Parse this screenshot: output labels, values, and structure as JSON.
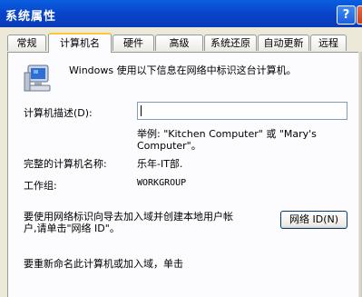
{
  "window": {
    "title": "系统属性",
    "help_label": "?"
  },
  "tabs": [
    {
      "label": "常规"
    },
    {
      "label": "计算机名"
    },
    {
      "label": "硬件"
    },
    {
      "label": "高级"
    },
    {
      "label": "系统还原"
    },
    {
      "label": "自动更新"
    },
    {
      "label": "远程"
    }
  ],
  "active_tab": "计算机名",
  "content": {
    "intro": "Windows 使用以下信息在网络中标识这台计算机。",
    "desc_label": "计算机描述(D):",
    "desc_value": "",
    "example_line1": "举例: \"Kitchen Computer\" 或 \"Mary's",
    "example_line2": "Computer\"。",
    "fullname_label": "完整的计算机名称:",
    "fullname_value": "乐年-IT部.",
    "workgroup_label": "工作组:",
    "workgroup_value": "WORKGROUP",
    "network_text_line1": "要使用网络标识向导去加入域并创建本地用户帐",
    "network_text_line2": "户,请单击\"网络 ID\"。",
    "network_button": "网络 ID(N)",
    "rename_text": "要重新命名此计算机或加入域，单击"
  }
}
